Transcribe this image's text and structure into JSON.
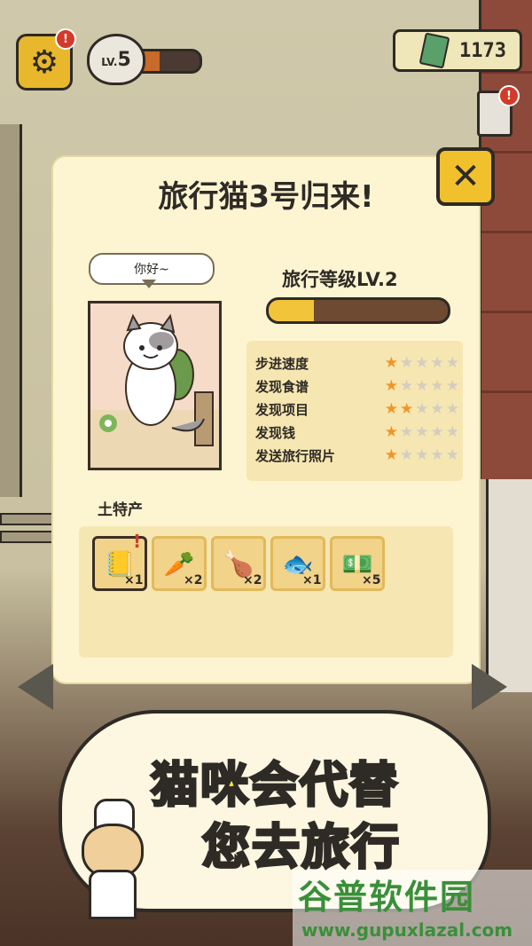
{
  "hud": {
    "level_prefix": "LV.",
    "level": "5",
    "level_progress": 0.35,
    "currency": "1173",
    "settings_badge": "!",
    "clipboard_badge": "!"
  },
  "dialog": {
    "title": "旅行猫3号归来!",
    "close_icon": "close-x",
    "speech": "你好~",
    "travel_level_label": "旅行等级LV.2",
    "travel_level_progress": 0.25,
    "stats": [
      {
        "label": "步进速度",
        "stars": 1
      },
      {
        "label": "发现食谱",
        "stars": 1
      },
      {
        "label": "发现项目",
        "stars": 2
      },
      {
        "label": "发现钱",
        "stars": 1
      },
      {
        "label": "发送旅行照片",
        "stars": 1
      }
    ],
    "stars_max": 5,
    "specialty_label": "土特产",
    "items": [
      {
        "icon": "recipe-book-icon",
        "glyph": "📒",
        "count": "×1",
        "badge": "!"
      },
      {
        "icon": "carrot-icon",
        "glyph": "🥕",
        "count": "×2"
      },
      {
        "icon": "meat-icon",
        "glyph": "🍗",
        "count": "×2"
      },
      {
        "icon": "fish-icon",
        "glyph": "🐟",
        "count": "×1"
      },
      {
        "icon": "cash-icon",
        "glyph": "💵",
        "count": "×5"
      }
    ]
  },
  "promo": {
    "line1": "猫咪会代替",
    "line2": "您去旅行"
  },
  "watermark": {
    "name": "谷普软件园",
    "url": "www.gupuxlazal.com"
  },
  "colors": {
    "accent_yellow": "#f0c12d",
    "panel_cream": "#fdf5d2",
    "star_on": "#f0952a",
    "star_off": "#d4cdc0",
    "promo_text": "#fbe13c"
  }
}
